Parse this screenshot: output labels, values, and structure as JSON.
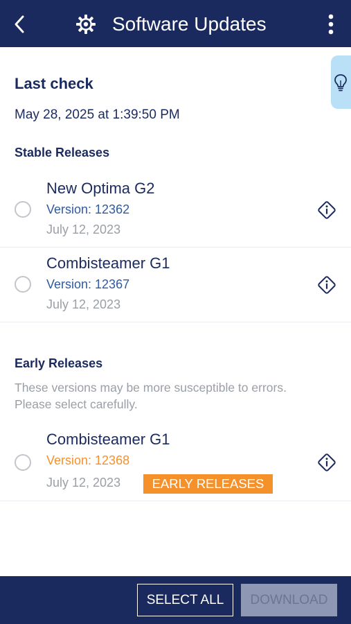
{
  "header": {
    "title": "Software Updates",
    "back_icon": "chevron-left-icon",
    "app_icon": "gear-icon",
    "more_icon": "kebab-menu-icon"
  },
  "side_tab": {
    "icon": "lightbulb-icon",
    "color": "#b9e0f6"
  },
  "last_check": {
    "label": "Last check",
    "value": "May 28, 2025 at 1:39:50 PM"
  },
  "stable": {
    "title": "Stable Releases",
    "items": [
      {
        "name": "New Optima G2",
        "version": "Version: 12362",
        "date": "July 12, 2023",
        "selected": false
      },
      {
        "name": "Combisteamer G1",
        "version": "Version: 12367",
        "date": "July 12, 2023",
        "selected": false
      }
    ]
  },
  "early": {
    "title": "Early Releases",
    "description": "These versions may be more susceptible to errors. Please select carefully.",
    "items": [
      {
        "name": "Combisteamer G1",
        "version": "Version: 12368",
        "date": "July 12, 2023",
        "badge": "EARLY RELEASES",
        "selected": false
      }
    ]
  },
  "footer": {
    "select_all": "SELECT ALL",
    "download": "DOWNLOAD"
  },
  "colors": {
    "primary": "#1b2a5e",
    "early_accent": "#f5912b",
    "version_blue": "#2f5aa0",
    "muted_text": "#9a9fa6"
  }
}
